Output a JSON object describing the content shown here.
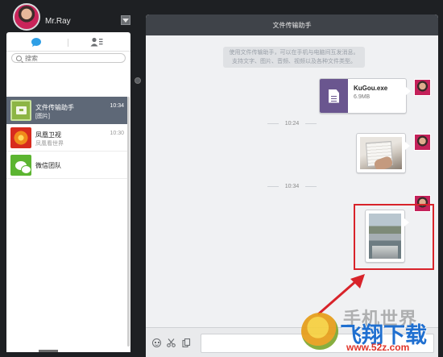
{
  "user": {
    "name": "Mr.Ray"
  },
  "search": {
    "placeholder": "搜索"
  },
  "conversations": [
    {
      "title": "文件传输助手",
      "subtitle": "[图片]",
      "time": "10:34",
      "active": true
    },
    {
      "title": "凤凰卫视",
      "subtitle": "凤凰看世界",
      "time": "10:30",
      "active": false
    },
    {
      "title": "微信团队",
      "subtitle": "",
      "time": "",
      "active": false
    }
  ],
  "chat": {
    "title": "文件传输助手",
    "system_line1": "使用文件传输助手，可以在手机与电脑间互发消息。",
    "system_line2": "支持文字、图片、音频、视频以及各种文件类型。",
    "file_name": "KuGou.exe",
    "file_size": "6.9MB",
    "time1": "10:24",
    "time2": "10:34"
  },
  "watermark": {
    "top": "手机世界",
    "main": "飞翔下载",
    "url": "www.52z.com"
  },
  "colors": {
    "accent_red": "#d8232a",
    "selected_row": "#5e6877",
    "file_icon": "#6a568f"
  }
}
